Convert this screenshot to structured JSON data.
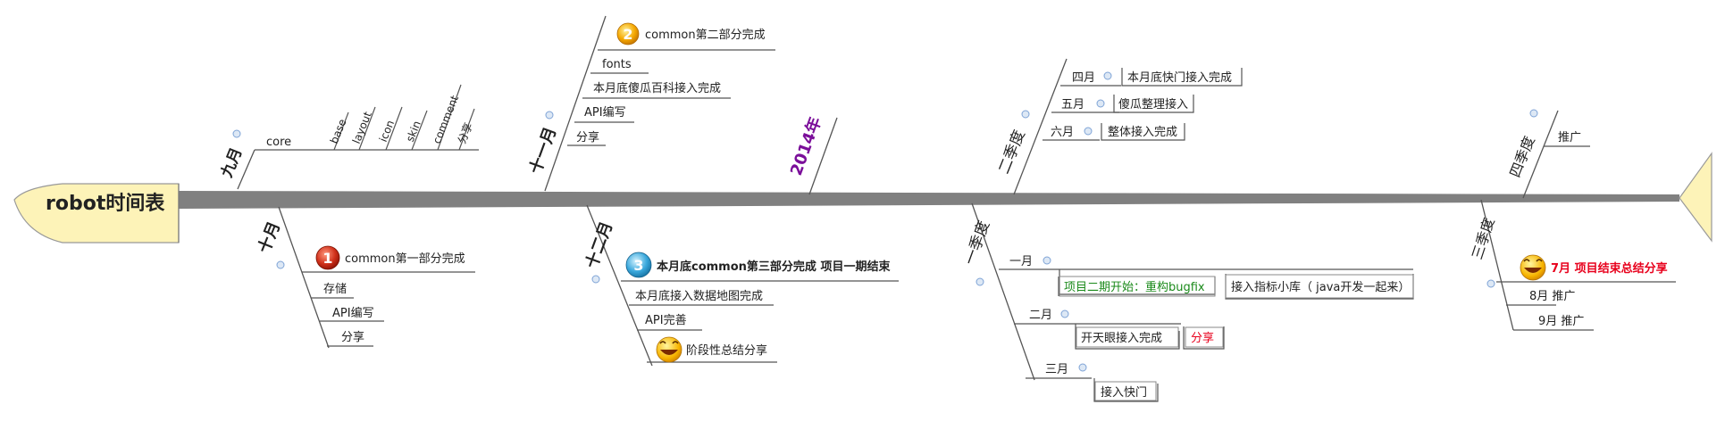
{
  "head": {
    "title": "robot时间表"
  },
  "year_label": "2014年",
  "colors": {
    "spine": "#808080",
    "line": "#555555",
    "head_fill": "#fdf3b8",
    "head_stroke": "#999999",
    "red": "#e8001c",
    "green": "#1a8a1a",
    "purple": "#7b0f9a",
    "collapse": "#7ea3d6"
  },
  "sep_month": {
    "label": "九月",
    "items": [
      "core",
      "base",
      "layout",
      "icon",
      "skin",
      "comment",
      "分享"
    ]
  },
  "nov_month": {
    "label": "十一月",
    "items": [
      {
        "text": "common第二部分完成",
        "badge": "2"
      },
      {
        "text": "fonts"
      },
      {
        "text": "本月底傻瓜百科接入完成"
      },
      {
        "text": "API编写"
      },
      {
        "text": "分享"
      }
    ]
  },
  "oct_month": {
    "label": "十月",
    "items": [
      {
        "text": "common第一部分完成",
        "badge": "1"
      },
      {
        "text": "存储"
      },
      {
        "text": "API编写"
      },
      {
        "text": "分享"
      }
    ]
  },
  "dec_month": {
    "label": "十二月",
    "items": [
      {
        "text": "本月底common第三部分完成 项目一期结束",
        "badge": "3"
      },
      {
        "text": "本月底接入数据地图完成"
      },
      {
        "text": "API完善"
      },
      {
        "text": "阶段性总结分享",
        "icon": "laugh"
      }
    ]
  },
  "q2": {
    "label": "二季度",
    "months": [
      {
        "label": "四月",
        "task": "本月底快门接入完成"
      },
      {
        "label": "五月",
        "task": "傻瓜整理接入"
      },
      {
        "label": "六月",
        "task": "整体接入完成"
      }
    ]
  },
  "q1": {
    "label": "一季度",
    "months": [
      {
        "label": "一月",
        "tasks": [
          "项目二期开始：重构bugfix",
          "接入指标小库（ java开发一起来）"
        ]
      },
      {
        "label": "二月",
        "tasks": [
          "开天眼接入完成",
          "分享"
        ]
      },
      {
        "label": "三月",
        "tasks": [
          "接入快门"
        ]
      }
    ]
  },
  "q4": {
    "label": "四季度",
    "items": [
      "推广"
    ]
  },
  "q3": {
    "label": "三季度",
    "items": [
      {
        "text": "7月 项目结束总结分享",
        "icon": "laugh"
      },
      {
        "text": "8月 推广"
      },
      {
        "text": "9月 推广"
      }
    ]
  }
}
